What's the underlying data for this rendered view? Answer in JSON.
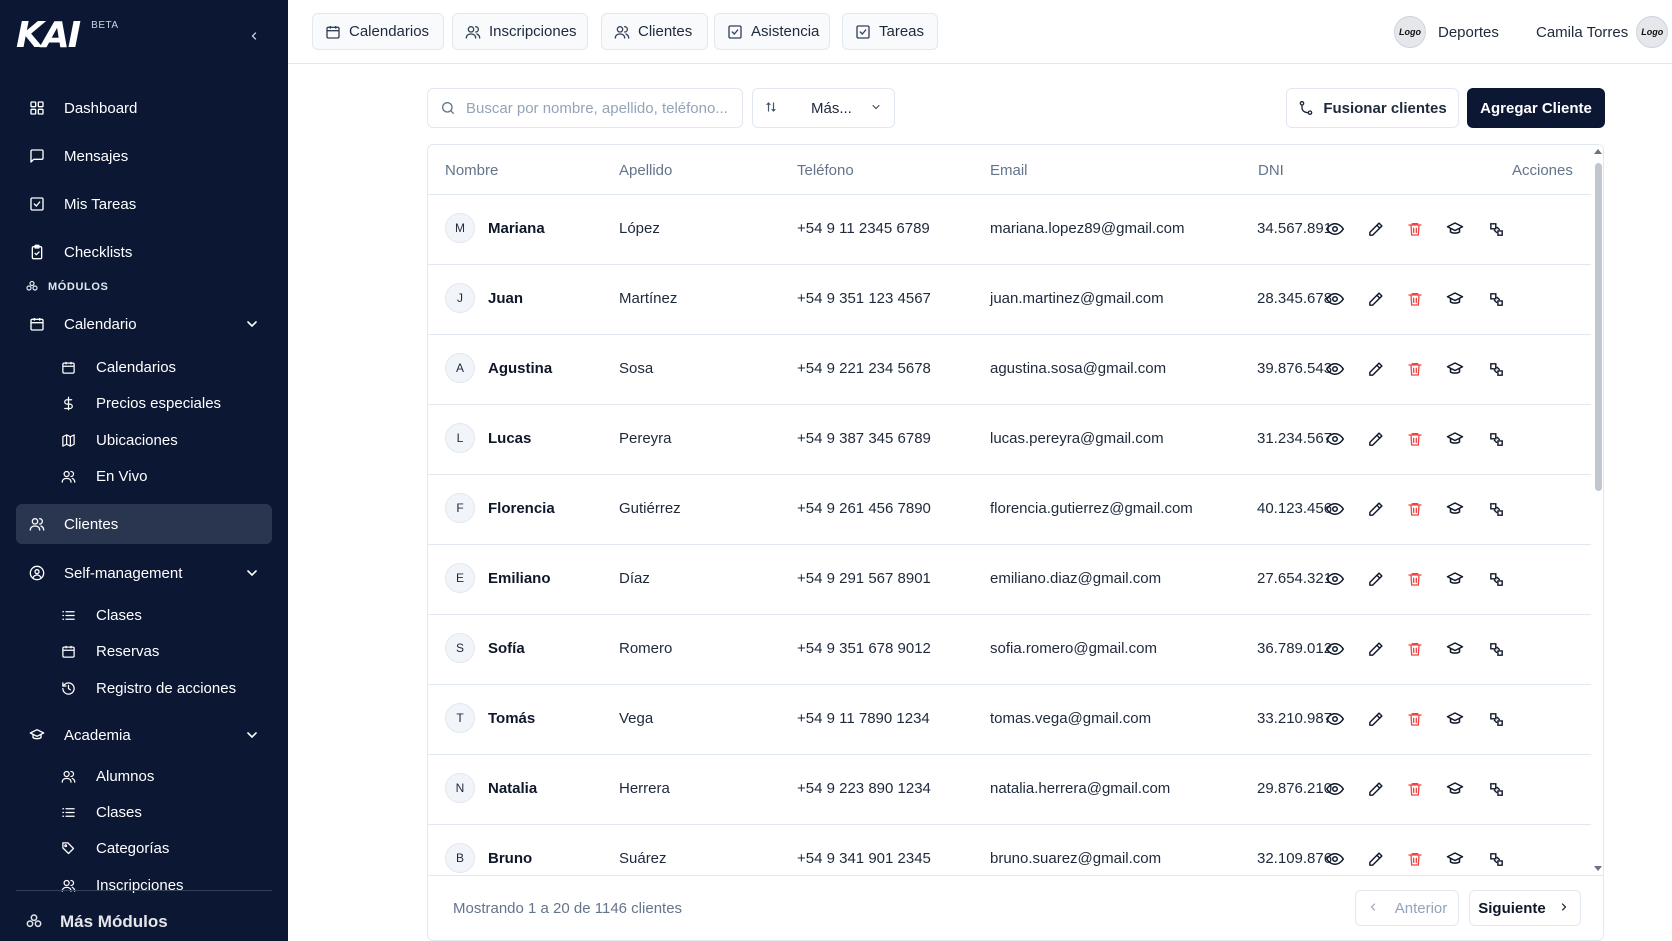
{
  "brand": {
    "logo_text": "KAI",
    "badge": "BETA"
  },
  "sidebar": {
    "items": [
      {
        "label": "Dashboard",
        "icon": "dashboard-icon"
      },
      {
        "label": "Mensajes",
        "icon": "message-icon"
      },
      {
        "label": "Mis Tareas",
        "icon": "checkbox-icon"
      },
      {
        "label": "Checklists",
        "icon": "clipboard-check-icon"
      }
    ],
    "section_label": "MÓDULOS",
    "calendario": {
      "label": "Calendario",
      "sub": [
        "Calendarios",
        "Precios especiales",
        "Ubicaciones",
        "En Vivo"
      ]
    },
    "clientes": {
      "label": "Clientes"
    },
    "self_management": {
      "label": "Self-management",
      "sub": [
        "Clases",
        "Reservas",
        "Registro de acciones"
      ]
    },
    "academia": {
      "label": "Academia",
      "sub": [
        "Alumnos",
        "Clases",
        "Categorías",
        "Inscripciones"
      ]
    },
    "more_modules": "Más Módulos"
  },
  "topbar": {
    "tabs": [
      "Calendarios",
      "Inscripciones",
      "Clientes",
      "Asistencia",
      "Tareas"
    ],
    "org": {
      "logo_text": "Logo",
      "label": "Deportes"
    },
    "user": {
      "label": "Camila Torres",
      "logo_text": "Logo"
    }
  },
  "toolbar": {
    "search_placeholder": "Buscar por nombre, apellido, teléfono...",
    "filter_label": "Más...",
    "merge_label": "Fusionar clientes",
    "add_label": "Agregar Cliente"
  },
  "table": {
    "columns": [
      "Nombre",
      "Apellido",
      "Teléfono",
      "Email",
      "DNI",
      "Acciones"
    ],
    "rows": [
      {
        "initial": "M",
        "nombre": "Mariana",
        "apellido": "López",
        "telefono": "+54 9 11 2345 6789",
        "email": "mariana.lopez89@gmail.com",
        "dni": "34.567.891"
      },
      {
        "initial": "J",
        "nombre": "Juan",
        "apellido": "Martínez",
        "telefono": "+54 9 351 123 4567",
        "email": "juan.martinez@gmail.com",
        "dni": "28.345.678"
      },
      {
        "initial": "A",
        "nombre": "Agustina",
        "apellido": "Sosa",
        "telefono": "+54 9 221 234 5678",
        "email": "agustina.sosa@gmail.com",
        "dni": "39.876.543"
      },
      {
        "initial": "L",
        "nombre": "Lucas",
        "apellido": "Pereyra",
        "telefono": "+54 9 387 345 6789",
        "email": "lucas.pereyra@gmail.com",
        "dni": "31.234.567"
      },
      {
        "initial": "F",
        "nombre": "Florencia",
        "apellido": "Gutiérrez",
        "telefono": "+54 9 261 456 7890",
        "email": "florencia.gutierrez@gmail.com",
        "dni": "40.123.456"
      },
      {
        "initial": "E",
        "nombre": "Emiliano",
        "apellido": "Díaz",
        "telefono": "+54 9 291 567 8901",
        "email": "emiliano.diaz@gmail.com",
        "dni": "27.654.321"
      },
      {
        "initial": "S",
        "nombre": "Sofía",
        "apellido": "Romero",
        "telefono": "+54 9 351 678 9012",
        "email": "sofia.romero@gmail.com",
        "dni": "36.789.012"
      },
      {
        "initial": "T",
        "nombre": "Tomás",
        "apellido": "Vega",
        "telefono": "+54 9 11 7890 1234",
        "email": "tomas.vega@gmail.com",
        "dni": "33.210.987"
      },
      {
        "initial": "N",
        "nombre": "Natalia",
        "apellido": "Herrera",
        "telefono": "+54 9 223 890 1234",
        "email": "natalia.herrera@gmail.com",
        "dni": "29.876.210"
      },
      {
        "initial": "B",
        "nombre": "Bruno",
        "apellido": "Suárez",
        "telefono": "+54 9 341 901 2345",
        "email": "bruno.suarez@gmail.com",
        "dni": "32.109.876"
      }
    ],
    "row_actions": [
      "view-icon",
      "edit-icon",
      "delete-icon",
      "academy-icon",
      "link-icon"
    ]
  },
  "footer": {
    "summary": "Mostrando 1 a 20 de 1146 clientes",
    "prev_label": "Anterior",
    "next_label": "Siguiente"
  },
  "colors": {
    "sidebar_bg": "#0b1733",
    "active_bg": "#2a3650",
    "danger": "#ef4444",
    "primary": "#0b1733"
  }
}
